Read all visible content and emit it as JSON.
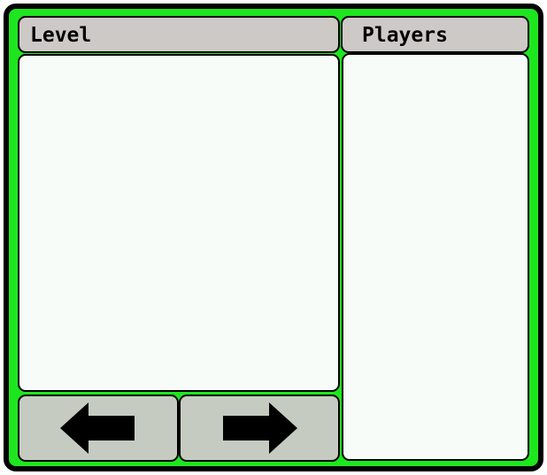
{
  "level_panel": {
    "title": "Level"
  },
  "players_panel": {
    "title": "Players"
  },
  "navigation": {
    "prev_icon": "arrow-left-icon",
    "next_icon": "arrow-right-icon"
  },
  "colors": {
    "frame_border": "#000000",
    "frame_fill": "#1ee61e",
    "header_fill": "#cdc9c6",
    "panel_fill": "#f8fcf8",
    "button_fill": "#c6cbc1"
  }
}
